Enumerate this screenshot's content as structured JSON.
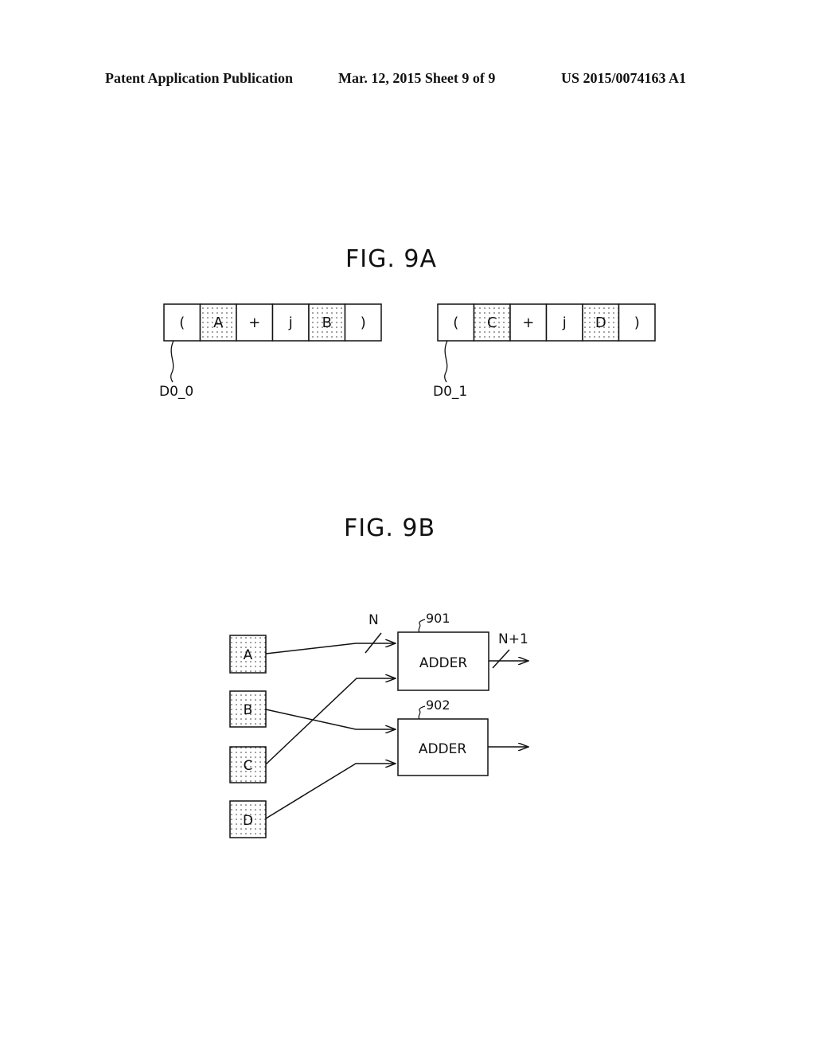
{
  "header": {
    "left": "Patent Application Publication",
    "center": "Mar. 12, 2015  Sheet 9 of 9",
    "right": "US 2015/0074163 A1"
  },
  "fig9a": {
    "title": "FIG. 9A",
    "registers": [
      {
        "label": "D0_0",
        "cells": [
          {
            "text": "(",
            "shaded": false
          },
          {
            "text": "A",
            "shaded": true
          },
          {
            "text": "+",
            "shaded": false
          },
          {
            "text": "j",
            "shaded": false
          },
          {
            "text": "B",
            "shaded": true
          },
          {
            "text": ")",
            "shaded": false
          }
        ]
      },
      {
        "label": "D0_1",
        "cells": [
          {
            "text": "(",
            "shaded": false
          },
          {
            "text": "C",
            "shaded": true
          },
          {
            "text": "+",
            "shaded": false
          },
          {
            "text": "j",
            "shaded": false
          },
          {
            "text": "D",
            "shaded": true
          },
          {
            "text": ")",
            "shaded": false
          }
        ]
      }
    ]
  },
  "fig9b": {
    "title": "FIG. 9B",
    "inputs": [
      "A",
      "B",
      "C",
      "D"
    ],
    "adders": [
      {
        "ref": "901",
        "label": "ADDER"
      },
      {
        "ref": "902",
        "label": "ADDER"
      }
    ],
    "bus_in_label": "N",
    "bus_out_label": "N+1"
  }
}
